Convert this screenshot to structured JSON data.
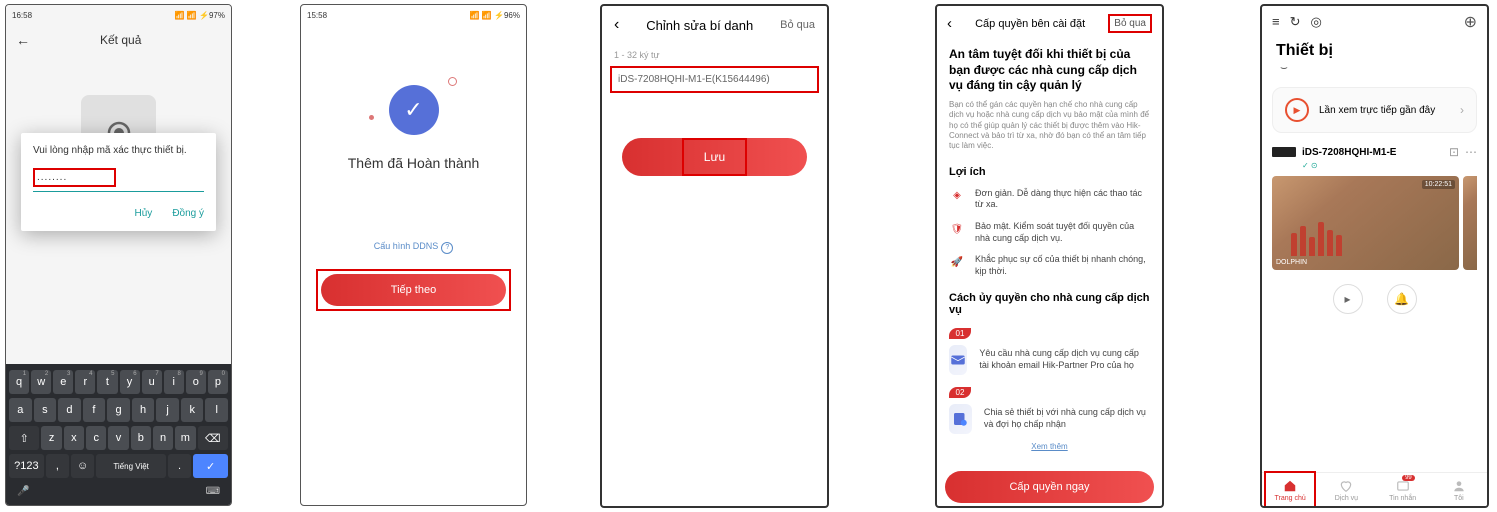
{
  "status": {
    "time1": "16:58",
    "batt1": "97%",
    "time2": "15:58",
    "batt2": "96%"
  },
  "p1": {
    "header": "Kết quả",
    "dialog_title": "Vui lòng nhập mã xác thực thiết bị.",
    "input": "........",
    "cancel": "Hủy",
    "ok": "Đồng ý",
    "kb_lang": "Tiếng Việt",
    "kb_sym": "?123"
  },
  "p2": {
    "title": "Thêm đã Hoàn thành",
    "ddns": "Cấu hình DDNS",
    "btn": "Tiếp theo"
  },
  "p3": {
    "title": "Chỉnh sửa bí danh",
    "skip": "Bỏ qua",
    "hint": "1 - 32 ký tự",
    "input": "iDS-7208HQHI-M1-E(K15644496)",
    "save": "Lưu"
  },
  "p4": {
    "title": "Cấp quyền bên cài đặt",
    "skip": "Bỏ qua",
    "h1": "An tâm tuyệt đối khi thiết bị của bạn được các nhà cung cấp dịch vụ đáng tin cậy quản lý",
    "desc": "Bạn có thể gán các quyền hạn chế cho nhà cung cấp dịch vụ hoặc nhà cung cấp dịch vụ bảo mật của mình để họ có thể giúp quản lý các thiết bị được thêm vào Hik-Connect và bảo trì từ xa, nhờ đó bạn có thể an tâm tiếp tục làm việc.",
    "benefits_title": "Lợi ích",
    "b1": "Đơn giản. Dễ dàng thực hiện các thao tác từ xa.",
    "b2": "Bảo mật. Kiểm soát tuyệt đối quyền của nhà cung cấp dịch vụ.",
    "b3": "Khắc phục sự cố của thiết bị nhanh chóng, kịp thời.",
    "howto_title": "Cách ủy quyền cho nhà cung cấp dịch vụ",
    "step1_badge": "01",
    "step1": "Yêu cầu nhà cung cấp dịch vụ cung cấp tài khoản email Hik-Partner Pro của họ",
    "step2_badge": "02",
    "step2": "Chia sẻ thiết bị với nhà cung cấp dịch vụ và đợi họ chấp nhận",
    "more": "Xem thêm",
    "cta": "Cấp quyền ngay"
  },
  "p5": {
    "title": "Thiết bị",
    "recent": "Lần xem trực tiếp gần đây",
    "device_name": "iDS-7208HQHI-M1-E",
    "ts": "10:22:51",
    "cam": "DOLPHIN",
    "nav": [
      "Trang chủ",
      "Dịch vụ",
      "Tin nhắn",
      "Tôi"
    ],
    "badge": "99"
  }
}
